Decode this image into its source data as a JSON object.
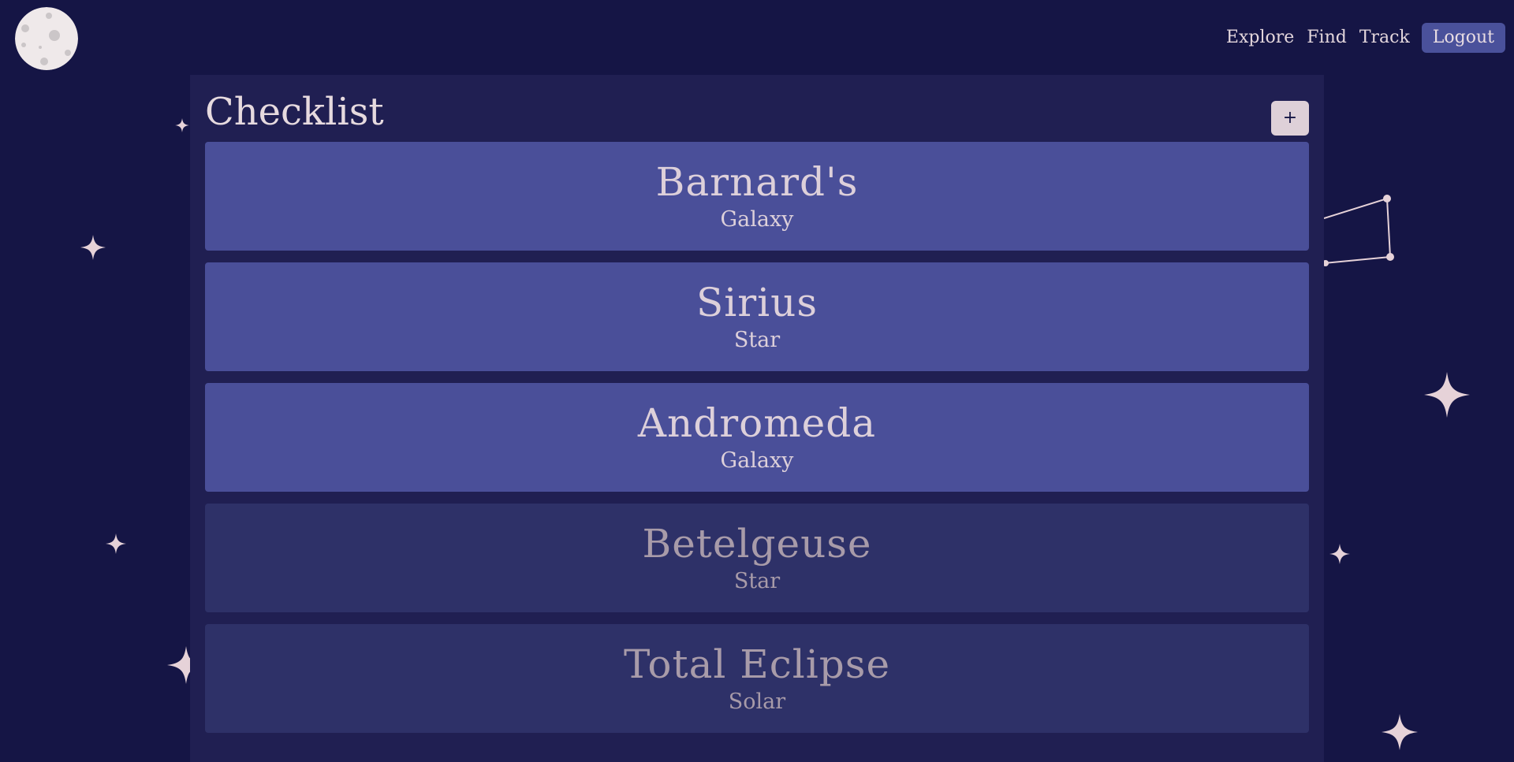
{
  "header": {
    "logo_icon": "moon-icon",
    "nav": {
      "explore": "Explore",
      "find": "Find",
      "track": "Track",
      "logout": "Logout"
    }
  },
  "checklist": {
    "title": "Checklist",
    "add_label": "+",
    "items": [
      {
        "name": "Barnard's",
        "type": "Galaxy",
        "active": true
      },
      {
        "name": "Sirius",
        "type": "Star",
        "active": true
      },
      {
        "name": "Andromeda",
        "type": "Galaxy",
        "active": true
      },
      {
        "name": "Betelgeuse",
        "type": "Star",
        "active": false
      },
      {
        "name": "Total Eclipse",
        "type": "Solar",
        "active": false
      }
    ]
  },
  "colors": {
    "background": "#151545",
    "panel": "#201f52",
    "card_active": "#4a4f99",
    "card_inactive": "#2e3168",
    "text": "#e6dadf",
    "accent_button": "#4a519b"
  },
  "decorations": {
    "star_icon": "sparkle-icon",
    "constellation_icon": "constellation-icon"
  }
}
